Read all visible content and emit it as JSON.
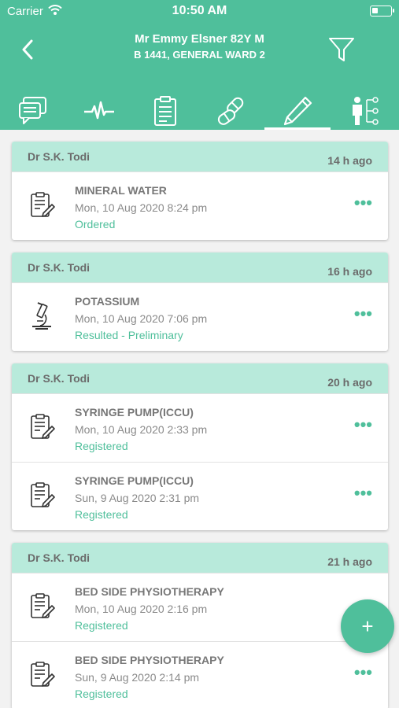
{
  "status_bar": {
    "carrier": "Carrier",
    "time": "10:50 AM"
  },
  "header": {
    "patient_name": "Mr Emmy Elsner 82Y M",
    "ward": "B 1441, GENERAL WARD 2",
    "back_icon": "chevron-left-icon",
    "filter_icon": "filter-icon"
  },
  "tabs": [
    {
      "icon": "chat-icon",
      "active": false
    },
    {
      "icon": "vitals-icon",
      "active": false
    },
    {
      "icon": "clipboard-icon",
      "active": false
    },
    {
      "icon": "pills-icon",
      "active": false
    },
    {
      "icon": "pen-icon",
      "active": true
    },
    {
      "icon": "person-tree-icon",
      "active": false
    }
  ],
  "colors": {
    "primary": "#4fbf9b",
    "card_header": "#b8eadb"
  },
  "groups": [
    {
      "doctor": "Dr S.K. Todi",
      "ago": "14 h ago",
      "items": [
        {
          "icon": "order-clipboard-icon",
          "name": "MINERAL WATER",
          "date": "Mon, 10 Aug 2020 8:24 pm",
          "status": "Ordered"
        }
      ]
    },
    {
      "doctor": "Dr S.K. Todi",
      "ago": "16 h ago",
      "items": [
        {
          "icon": "microscope-icon",
          "name": "POTASSIUM",
          "date": "Mon, 10 Aug 2020 7:06 pm",
          "status": "Resulted - Preliminary"
        }
      ]
    },
    {
      "doctor": "Dr S.K. Todi",
      "ago": "20 h ago",
      "items": [
        {
          "icon": "order-clipboard-icon",
          "name": "SYRINGE PUMP(ICCU)",
          "date": "Mon, 10 Aug 2020 2:33 pm",
          "status": "Registered"
        },
        {
          "icon": "order-clipboard-icon",
          "name": "SYRINGE PUMP(ICCU)",
          "date": "Sun, 9 Aug 2020 2:31 pm",
          "status": "Registered"
        }
      ]
    },
    {
      "doctor": "Dr S.K. Todi",
      "ago": "21 h ago",
      "items": [
        {
          "icon": "order-clipboard-icon",
          "name": "BED SIDE PHYSIOTHERAPY",
          "date": "Mon, 10 Aug 2020 2:16 pm",
          "status": "Registered"
        },
        {
          "icon": "order-clipboard-icon",
          "name": "BED SIDE PHYSIOTHERAPY",
          "date": "Sun, 9 Aug 2020 2:14 pm",
          "status": "Registered"
        }
      ]
    }
  ],
  "more_label": "•••",
  "fab_label": "+"
}
